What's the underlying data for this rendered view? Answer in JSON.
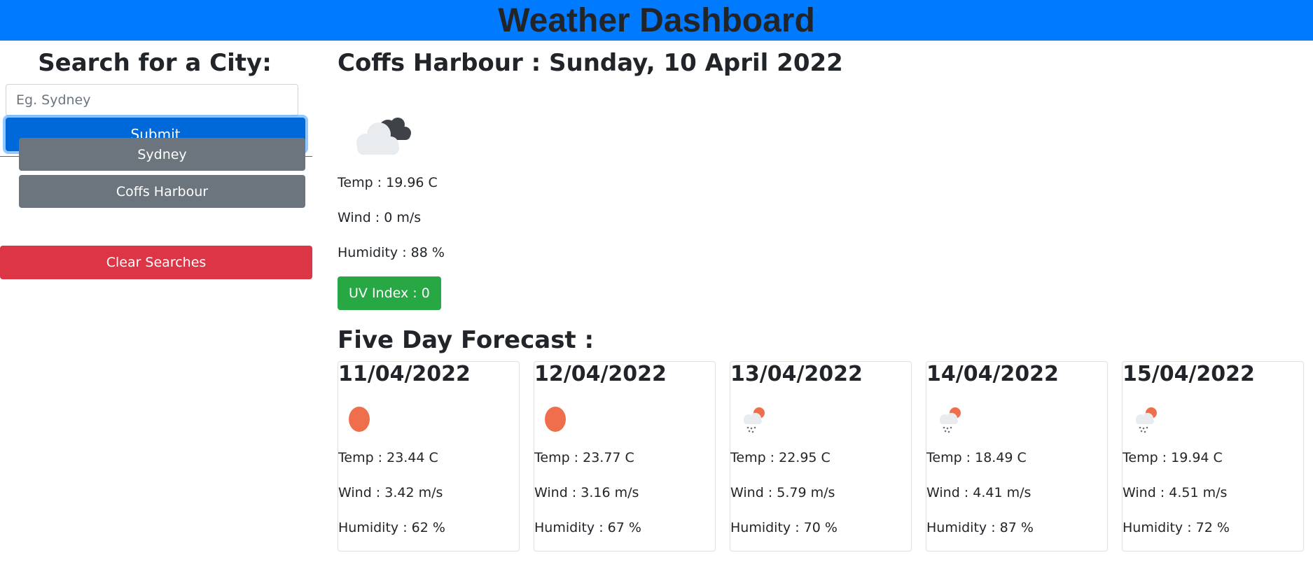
{
  "header": {
    "title": "Weather Dashboard"
  },
  "sidebar": {
    "search_heading": "Search for a City:",
    "search_placeholder": "Eg. Sydney",
    "submit_label": "Submit",
    "history": [
      {
        "label": "Sydney"
      },
      {
        "label": "Coffs Harbour"
      }
    ],
    "clear_label": "Clear Searches"
  },
  "current": {
    "title": "Coffs Harbour : Sunday, 10 April 2022",
    "icon": "cloudy-icon",
    "temp": "Temp : 19.96 C",
    "wind": "Wind : 0 m/s",
    "humidity": "Humidity : 88 %",
    "uv": "UV Index : 0",
    "uv_color": "#28a745"
  },
  "forecast": {
    "title": "Five Day Forecast :",
    "days": [
      {
        "date": "11/04/2022",
        "icon": "sun-icon",
        "temp": "Temp : 23.44 C",
        "wind": "Wind : 3.42 m/s",
        "humidity": "Humidity : 62 %"
      },
      {
        "date": "12/04/2022",
        "icon": "sun-icon",
        "temp": "Temp : 23.77 C",
        "wind": "Wind : 3.16 m/s",
        "humidity": "Humidity : 67 %"
      },
      {
        "date": "13/04/2022",
        "icon": "sun-rain-icon",
        "temp": "Temp : 22.95 C",
        "wind": "Wind : 5.79 m/s",
        "humidity": "Humidity : 70 %"
      },
      {
        "date": "14/04/2022",
        "icon": "sun-rain-icon",
        "temp": "Temp : 18.49 C",
        "wind": "Wind : 4.41 m/s",
        "humidity": "Humidity : 87 %"
      },
      {
        "date": "15/04/2022",
        "icon": "sun-rain-icon",
        "temp": "Temp : 19.94 C",
        "wind": "Wind : 4.51 m/s",
        "humidity": "Humidity : 72 %"
      }
    ]
  },
  "colors": {
    "header_bg": "#007bff",
    "submit_bg": "#0069d9",
    "history_bg": "#6c757d",
    "clear_bg": "#dc3545",
    "sun": "#ef6f4c"
  }
}
